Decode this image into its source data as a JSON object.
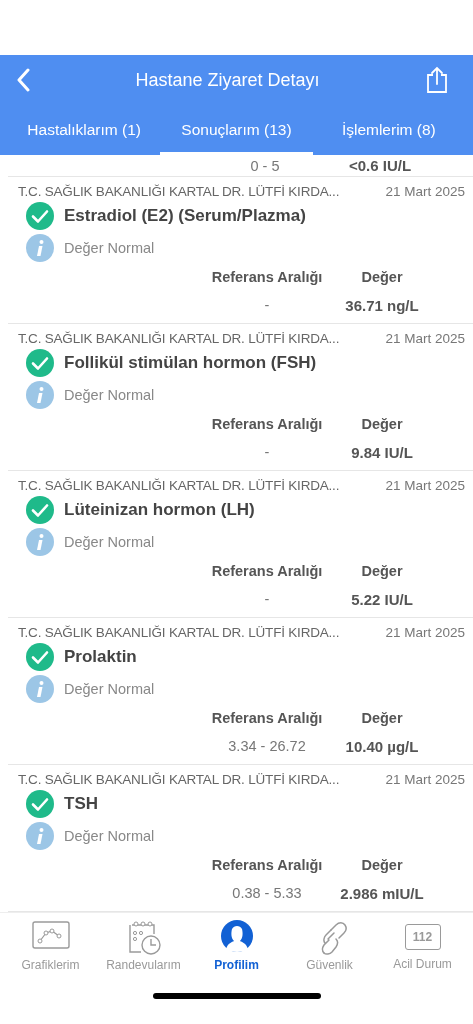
{
  "header": {
    "title": "Hastane Ziyaret Detayı"
  },
  "tabs": [
    {
      "label": "Hastalıklarım (1)",
      "selected": false
    },
    {
      "label": "Sonuçlarım (13)",
      "selected": true
    },
    {
      "label": "İşlemlerim (8)",
      "selected": false
    }
  ],
  "partial_row": {
    "reference": "0 - 5",
    "value": "<0.6 IU/L"
  },
  "results": [
    {
      "hospital": "T.C. SAĞLIK BAKANLIĞI KARTAL DR. LÜTFİ KIRDA...",
      "date": "21 Mart 2025",
      "name": "Estradiol (E2) (Serum/Plazma)",
      "kind": "normal",
      "status_text": "Değer Normal",
      "reference_header": "Referans Aralığı",
      "value_header": "Değer",
      "reference": "-",
      "value": "36.71 ng/L"
    },
    {
      "hospital": "T.C. SAĞLIK BAKANLIĞI KARTAL DR. LÜTFİ KIRDA...",
      "date": "21 Mart 2025",
      "name": "Follikül stimülan hormon (FSH)",
      "kind": "normal",
      "status_text": "Değer Normal",
      "reference_header": "Referans Aralığı",
      "value_header": "Değer",
      "reference": "-",
      "value": "9.84 IU/L"
    },
    {
      "hospital": "T.C. SAĞLIK BAKANLIĞI KARTAL DR. LÜTFİ KIRDA...",
      "date": "21 Mart 2025",
      "name": "Lüteinizan hormon (LH)",
      "kind": "normal",
      "status_text": "Değer Normal",
      "reference_header": "Referans Aralığı",
      "value_header": "Değer",
      "reference": "-",
      "value": "5.22 IU/L"
    },
    {
      "hospital": "T.C. SAĞLIK BAKANLIĞI KARTAL DR. LÜTFİ KIRDA...",
      "date": "21 Mart 2025",
      "name": "Prolaktin",
      "kind": "normal",
      "status_text": "Değer Normal",
      "reference_header": "Referans Aralığı",
      "value_header": "Değer",
      "reference": "3.34 - 26.72",
      "value": "10.40 µg/L"
    },
    {
      "hospital": "T.C. SAĞLIK BAKANLIĞI KARTAL DR. LÜTFİ KIRDA...",
      "date": "21 Mart 2025",
      "name": "TSH",
      "kind": "normal",
      "status_text": "Değer Normal",
      "reference_header": "Referans Aralığı",
      "value_header": "Değer",
      "reference": "0.38 - 5.33",
      "value": "2.986 mIU/L"
    }
  ],
  "bottom_nav": [
    {
      "kind": "chart",
      "label": "Grafiklerim",
      "selected": false
    },
    {
      "kind": "calendar",
      "label": "Randevularım",
      "selected": false
    },
    {
      "kind": "profile",
      "label": "Profilim",
      "selected": true
    },
    {
      "kind": "link",
      "label": "Güvenlik",
      "selected": false
    },
    {
      "kind": "emergency",
      "label": "Acil Durum",
      "icon_text": "112",
      "selected": false
    }
  ]
}
